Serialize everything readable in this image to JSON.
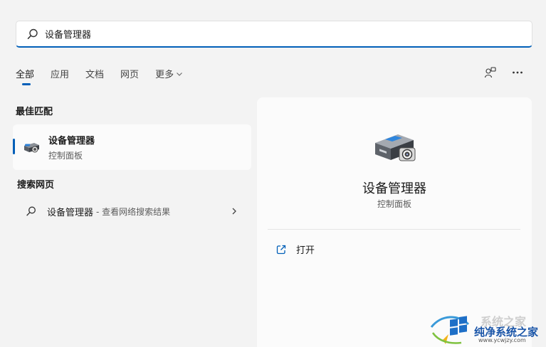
{
  "search": {
    "value": "设备管理器",
    "placeholder": ""
  },
  "tabs": [
    {
      "label": "全部",
      "active": true
    },
    {
      "label": "应用"
    },
    {
      "label": "文档"
    },
    {
      "label": "网页"
    },
    {
      "label": "更多"
    }
  ],
  "toolbar": {
    "account_icon": "account-switch-icon",
    "more_icon": "ellipsis-icon"
  },
  "best_match": {
    "title": "最佳匹配",
    "item": {
      "name": "设备管理器",
      "subtitle": "控制面板",
      "icon": "device-manager-icon"
    }
  },
  "web_search": {
    "title": "搜索网页",
    "item": {
      "name": "设备管理器",
      "suffix": "- 查看网络搜索结果",
      "icon": "search-icon"
    }
  },
  "detail": {
    "name": "设备管理器",
    "subtitle": "控制面板",
    "actions": [
      {
        "label": "打开",
        "icon": "open-external-icon"
      }
    ]
  },
  "watermark": {
    "text": "纯净系统之家",
    "url": "www.ycwjzy.com",
    "ghost_text": "系统之家"
  },
  "colors": {
    "accent": "#005fb8",
    "background": "#f3f3f3",
    "card": "#fbfbfb"
  }
}
